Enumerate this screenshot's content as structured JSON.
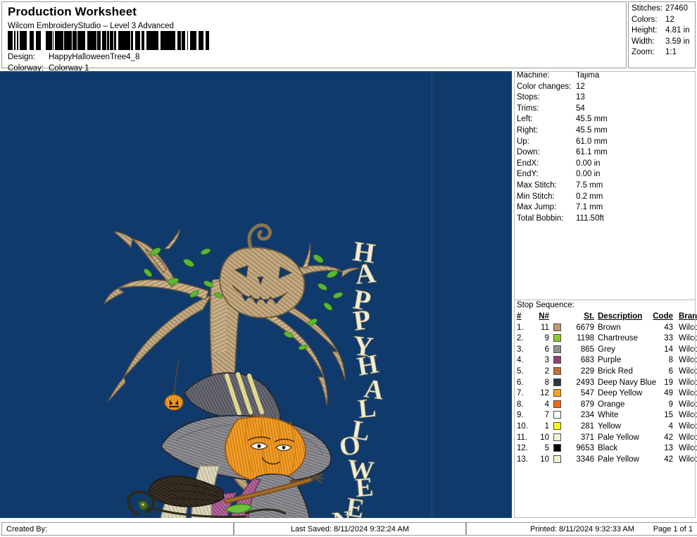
{
  "header": {
    "title": "Production Worksheet",
    "subtitle": "Wilcom EmbroideryStudio – Level 3 Advanced",
    "barcode_icon": "barcode",
    "design_label": "Design:",
    "design_value": "HappyHalloweenTree4_8",
    "colorway_label": "Colorway:",
    "colorway_value": "Colorway 1",
    "summary": [
      {
        "key": "Stitches:",
        "value": "27460"
      },
      {
        "key": "Colors:",
        "value": "12"
      },
      {
        "key": "Height:",
        "value": "4.81 in"
      },
      {
        "key": "Width:",
        "value": "3.59 in"
      },
      {
        "key": "Zoom:",
        "value": "1:1"
      }
    ]
  },
  "canvas": {
    "background_color": "#103a6b",
    "design_name": "HappyHalloweenTree4_8",
    "artwork_description": "Halloween embroidery: bare tree with jack-o-lantern face, scarecrow with pumpkin head wearing witch hat holding broom, lettering HAPPY HALLOWEEN",
    "lettering_top": "HAPPY",
    "lettering_bottom": "HALLOWEEN"
  },
  "panel": {
    "stats": [
      {
        "key": "Machine:",
        "value": "Tajima"
      },
      {
        "key": "Color changes:",
        "value": "12"
      },
      {
        "key": "Stops:",
        "value": "13"
      },
      {
        "key": "Trims:",
        "value": "54"
      },
      {
        "key": "Left:",
        "value": "45.5 mm"
      },
      {
        "key": "Right:",
        "value": "45.5 mm"
      },
      {
        "key": "Up:",
        "value": "61.0 mm"
      },
      {
        "key": "Down:",
        "value": "61.1 mm"
      },
      {
        "key": "EndX:",
        "value": "0.00 in"
      },
      {
        "key": "EndY:",
        "value": "0.00 in"
      },
      {
        "key": "Max Stitch:",
        "value": "7.5 mm"
      },
      {
        "key": "Min Stitch:",
        "value": "0.2 mm"
      },
      {
        "key": "Max Jump:",
        "value": "7.1 mm"
      },
      {
        "key": "Total Bobbin:",
        "value": "111.50ft"
      }
    ],
    "stop_sequence_caption": "Stop Sequence:",
    "table_headers": {
      "num": "#",
      "needle": "N#",
      "stitches": "St.",
      "description": "Description",
      "code": "Code",
      "brand": "Brand"
    },
    "rows": [
      {
        "num": "1.",
        "needle": "11",
        "color": "#bd9873",
        "stitches": "6679",
        "description": "Brown",
        "code": "43",
        "brand": "Wilcom"
      },
      {
        "num": "2.",
        "needle": "9",
        "color": "#86cc2b",
        "stitches": "1198",
        "description": "Chartreuse",
        "code": "33",
        "brand": "Wilcom"
      },
      {
        "num": "3.",
        "needle": "6",
        "color": "#909090",
        "stitches": "865",
        "description": "Grey",
        "code": "14",
        "brand": "Wilcom"
      },
      {
        "num": "4.",
        "needle": "3",
        "color": "#93407a",
        "stitches": "683",
        "description": "Purple",
        "code": "8",
        "brand": "Wilcom"
      },
      {
        "num": "5.",
        "needle": "2",
        "color": "#c2703a",
        "stitches": "229",
        "description": "Brick Red",
        "code": "6",
        "brand": "Wilcom"
      },
      {
        "num": "6.",
        "needle": "8",
        "color": "#2c3642",
        "stitches": "2493",
        "description": "Deep Navy Blue",
        "code": "19",
        "brand": "Wilcom"
      },
      {
        "num": "7.",
        "needle": "12",
        "color": "#f9a312",
        "stitches": "547",
        "description": "Deep Yellow",
        "code": "49",
        "brand": "Wilcom"
      },
      {
        "num": "8.",
        "needle": "4",
        "color": "#ef6a15",
        "stitches": "879",
        "description": "Orange",
        "code": "9",
        "brand": "Wilcom"
      },
      {
        "num": "9.",
        "needle": "7",
        "color": "#ffffff",
        "stitches": "234",
        "description": "White",
        "code": "15",
        "brand": "Wilcom"
      },
      {
        "num": "10.",
        "needle": "1",
        "color": "#fbf61a",
        "stitches": "281",
        "description": "Yellow",
        "code": "4",
        "brand": "Wilcom"
      },
      {
        "num": "11.",
        "needle": "10",
        "color": "#f4f2d6",
        "stitches": "371",
        "description": "Pale Yellow",
        "code": "42",
        "brand": "Wilcom"
      },
      {
        "num": "12.",
        "needle": "5",
        "color": "#000000",
        "stitches": "9653",
        "description": "Black",
        "code": "13",
        "brand": "Wilcom"
      },
      {
        "num": "13.",
        "needle": "10",
        "color": "#f4f2d6",
        "stitches": "3346",
        "description": "Pale Yellow",
        "code": "42",
        "brand": "Wilcom"
      }
    ]
  },
  "footer": {
    "created_by": "Created By:",
    "last_saved": "Last Saved: 8/11/2024 9:32:24 AM",
    "printed": "Printed: 8/11/2024 9:32:33 AM",
    "page": "Page 1 of 1"
  }
}
